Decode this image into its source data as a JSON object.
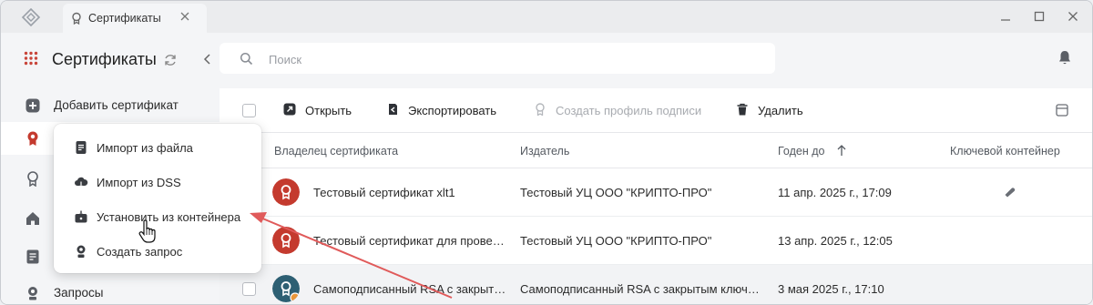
{
  "titlebar": {
    "tab_label": "Сертификаты",
    "icons": [
      "app-logo-icon",
      "certificate-tab-icon",
      "close-icon",
      "minimize-icon",
      "maximize-icon",
      "close-window-icon"
    ]
  },
  "sidebar": {
    "title": "Сертификаты",
    "items": [
      {
        "label": "Добавить сертификат",
        "icon": "plus-icon"
      },
      {
        "label": "",
        "icon": "certificate-icon"
      },
      {
        "label": "",
        "icon": "award-icon"
      },
      {
        "label": "",
        "icon": "home-icon"
      },
      {
        "label": "",
        "icon": "document-icon"
      },
      {
        "label": "Запросы",
        "icon": "request-icon"
      }
    ]
  },
  "search": {
    "placeholder": "Поиск"
  },
  "toolbar": {
    "open": "Открыть",
    "export": "Экспортировать",
    "create_profile": "Создать профиль подписи",
    "delete": "Удалить"
  },
  "table": {
    "columns": [
      "Владелец сертификата",
      "Издатель",
      "Годен до",
      "Ключевой контейнер"
    ],
    "rows": [
      {
        "owner": "Тестовый сертификат xlt1",
        "issuer": "Тестовый УЦ ООО \"КРИПТО-ПРО\"",
        "valid_to": "11 апр. 2025 г., 17:09",
        "has_key": true
      },
      {
        "owner": "Тестовый сертификат для прове…",
        "issuer": "Тестовый УЦ ООО \"КРИПТО-ПРО\"",
        "valid_to": "13 апр. 2025 г., 12:05",
        "has_key": false
      },
      {
        "owner": "Самоподписанный RSA с закрыт…",
        "issuer": "Самоподписанный RSA с закрытым ключ…",
        "valid_to": "3 мая 2025 г., 17:10",
        "has_key": false
      }
    ]
  },
  "dropdown": {
    "items": [
      {
        "label": "Импорт из файла",
        "icon": "file-icon"
      },
      {
        "label": "Импорт из DSS",
        "icon": "cloud-icon"
      },
      {
        "label": "Установить из контейнера",
        "icon": "container-icon"
      },
      {
        "label": "Создать запрос",
        "icon": "request-icon"
      }
    ]
  },
  "colors": {
    "accent_red": "#c43a2e",
    "accent_teal": "#2d5f73",
    "annotation_arrow": "#e05a5a"
  }
}
